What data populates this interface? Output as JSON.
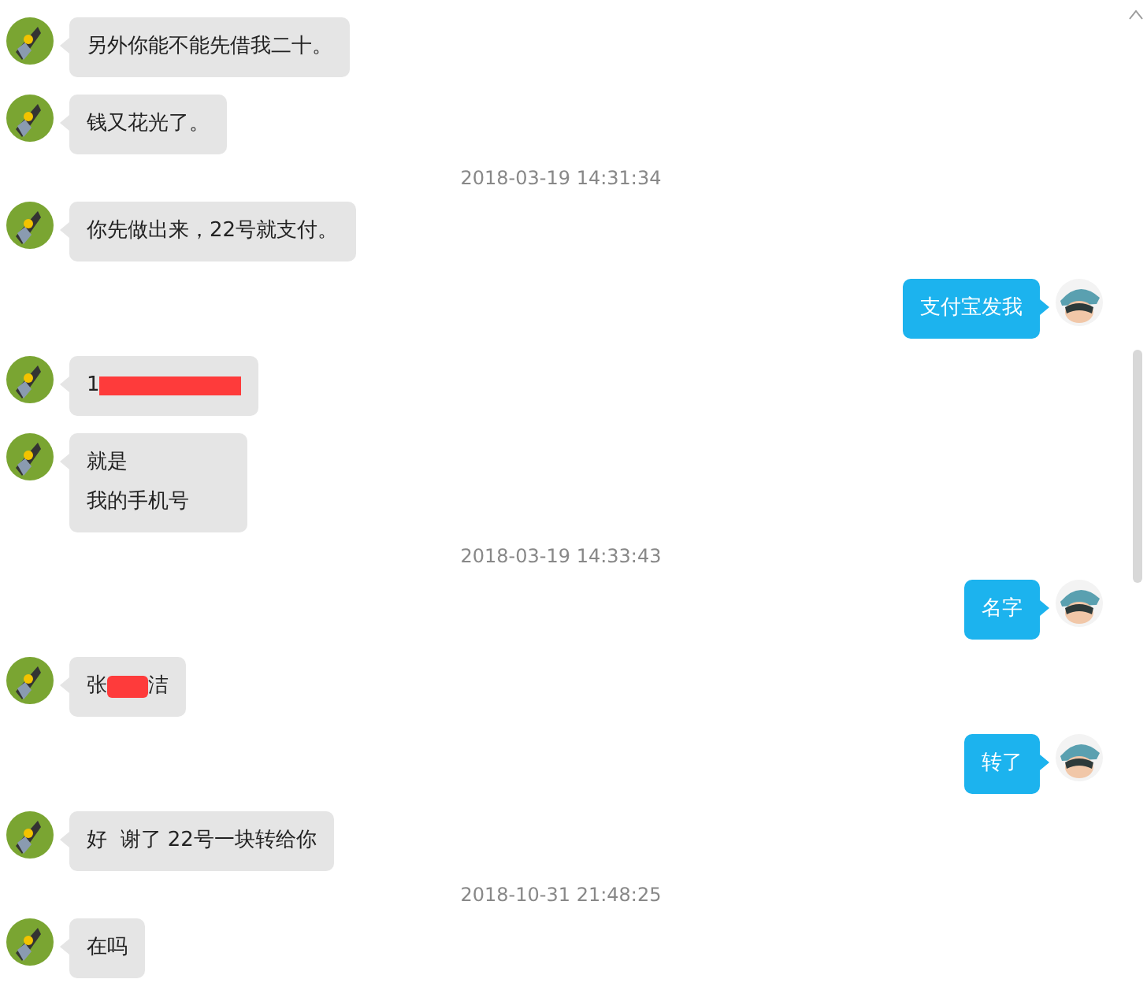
{
  "messages": [
    {
      "kind": "message",
      "outgoing": false,
      "segments": [
        {
          "kind": "text",
          "text": "另外你能不能先借我二十。"
        }
      ]
    },
    {
      "kind": "message",
      "outgoing": false,
      "segments": [
        {
          "kind": "text",
          "text": "钱又花光了。"
        }
      ]
    },
    {
      "kind": "time",
      "text": "2018-03-19 14:31:34"
    },
    {
      "kind": "message",
      "outgoing": false,
      "segments": [
        {
          "kind": "text",
          "text": "你先做出来，22号就支付。"
        }
      ]
    },
    {
      "kind": "message",
      "outgoing": true,
      "segments": [
        {
          "kind": "text",
          "text": "支付宝发我"
        }
      ]
    },
    {
      "kind": "message",
      "outgoing": false,
      "segments": [
        {
          "kind": "text",
          "text": "1"
        },
        {
          "kind": "redacted"
        }
      ]
    },
    {
      "kind": "message",
      "outgoing": false,
      "segments": [
        {
          "kind": "text",
          "text": "就是"
        },
        {
          "kind": "break"
        },
        {
          "kind": "text",
          "text": "我的手机号"
        }
      ]
    },
    {
      "kind": "time",
      "text": "2018-03-19 14:33:43"
    },
    {
      "kind": "message",
      "outgoing": true,
      "segments": [
        {
          "kind": "text",
          "text": "名字"
        }
      ]
    },
    {
      "kind": "message",
      "outgoing": false,
      "segments": [
        {
          "kind": "text",
          "text": "张"
        },
        {
          "kind": "redacted"
        },
        {
          "kind": "text",
          "text": "洁"
        }
      ]
    },
    {
      "kind": "message",
      "outgoing": true,
      "segments": [
        {
          "kind": "text",
          "text": "转了"
        }
      ]
    },
    {
      "kind": "message",
      "outgoing": false,
      "segments": [
        {
          "kind": "text",
          "text": "好  谢了 22号一块转给你"
        }
      ]
    },
    {
      "kind": "time",
      "text": "2018-10-31 21:48:25"
    },
    {
      "kind": "message",
      "outgoing": false,
      "segments": [
        {
          "kind": "text",
          "text": "在吗"
        }
      ]
    }
  ]
}
